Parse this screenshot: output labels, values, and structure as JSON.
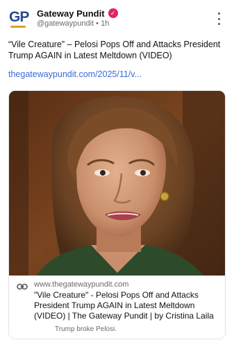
{
  "account": {
    "avatar_text": "GP",
    "display_name": "Gateway Pundit",
    "handle": "@gatewaypundit",
    "separator": "•",
    "time": "1h",
    "verified_icon": "verified-badge-icon",
    "verified_color": "#e0245e"
  },
  "post": {
    "text": "“Vile Creature” – Pelosi Pops Off and Attacks President Trump AGAIN in Latest Meltdown (VIDEO)",
    "link_text": "thegatewaypundit.com/2025/11/v..."
  },
  "link_card": {
    "domain": "www.thegatewaypundit.com",
    "title": "\"Vile Creature\" - Pelosi Pops Off and Attacks President Trump AGAIN in Latest Meltdown (VIDEO) | The Gateway Pundit | by Cristina Laila",
    "description": "Trump broke Pelosi.",
    "link_icon": "link-icon"
  },
  "menu": {
    "more_icon": "more-options-icon"
  },
  "colors": {
    "link": "#3a6ad6",
    "muted": "#6b6b6b",
    "brand_blue": "#2a4a8f",
    "brand_gold": "#d8a21a"
  }
}
